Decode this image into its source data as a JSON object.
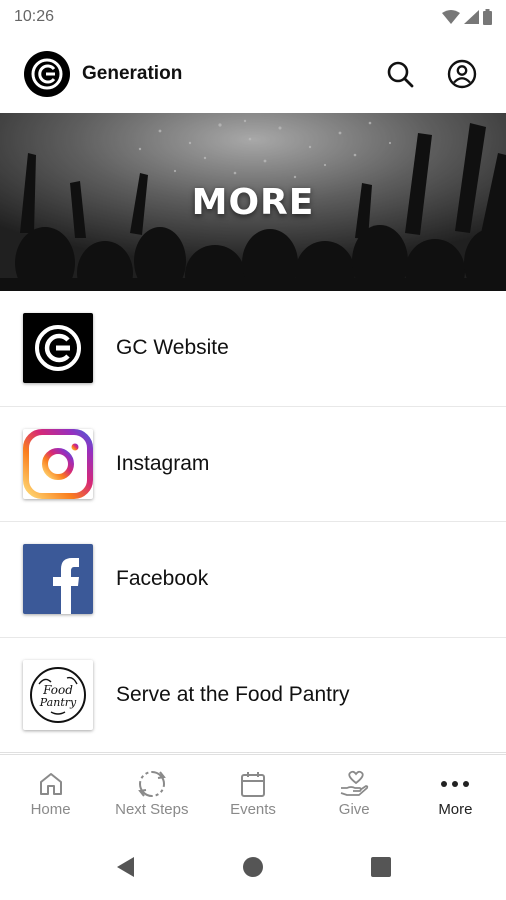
{
  "status_bar": {
    "time": "10:26",
    "icons": [
      "wifi-icon",
      "signal-icon",
      "battery-icon"
    ]
  },
  "app_bar": {
    "title": "Generation",
    "logo_icon": "generation-logo-icon",
    "actions": [
      "search-icon",
      "account-icon"
    ]
  },
  "hero": {
    "title": "MORE"
  },
  "items": [
    {
      "label": "GC Website",
      "icon": "gc-logo-icon"
    },
    {
      "label": "Instagram",
      "icon": "instagram-icon"
    },
    {
      "label": "Facebook",
      "icon": "facebook-icon"
    },
    {
      "label": "Serve at the Food Pantry",
      "icon": "food-pantry-icon",
      "icon_text": [
        "Food",
        "Pantry"
      ]
    }
  ],
  "bottom_nav": [
    {
      "label": "Home",
      "icon": "home-icon",
      "active": false
    },
    {
      "label": "Next Steps",
      "icon": "next-steps-icon",
      "active": false
    },
    {
      "label": "Events",
      "icon": "calendar-icon",
      "active": false
    },
    {
      "label": "Give",
      "icon": "give-icon",
      "active": false
    },
    {
      "label": "More",
      "icon": "more-dots-icon",
      "active": true
    }
  ],
  "colors": {
    "active": "#222222",
    "inactive": "#8a8a8a",
    "facebook": "#3b5998",
    "instagram": [
      "#feda75",
      "#d62976",
      "#962fbf",
      "#4f5bd5"
    ]
  }
}
